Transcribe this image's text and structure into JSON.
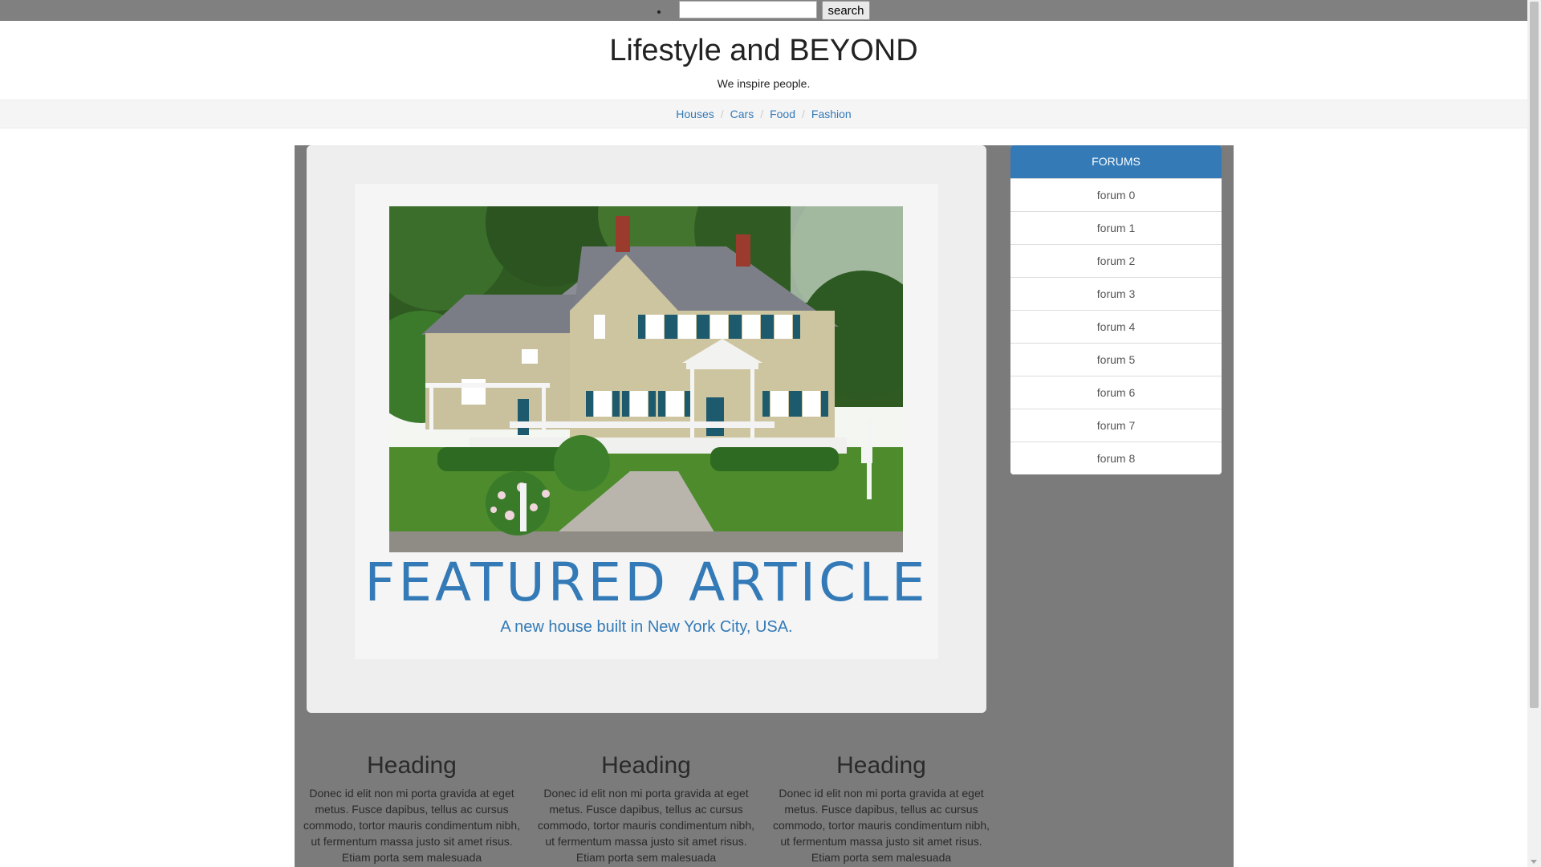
{
  "search": {
    "placeholder": "",
    "button_label": "search"
  },
  "header": {
    "title": "Lifestyle and BEYOND",
    "tagline": "We inspire people."
  },
  "nav": {
    "items": [
      "Houses",
      "Cars",
      "Food",
      "Fashion"
    ],
    "separator": "/"
  },
  "feature": {
    "image_alt": "house",
    "title": "FEATURED ARTICLE",
    "subtitle": "A new house built in New York City, USA."
  },
  "forums": {
    "header": "FORUMS",
    "items": [
      "forum 0",
      "forum 1",
      "forum 2",
      "forum 3",
      "forum 4",
      "forum 5",
      "forum 6",
      "forum 7",
      "forum 8"
    ]
  },
  "columns": [
    {
      "heading": "Heading",
      "text": "Donec id elit non mi porta gravida at eget metus. Fusce dapibus, tellus ac cursus commodo, tortor mauris condimentum nibh, ut fermentum massa justo sit amet risus. Etiam porta sem malesuada"
    },
    {
      "heading": "Heading",
      "text": "Donec id elit non mi porta gravida at eget metus. Fusce dapibus, tellus ac cursus commodo, tortor mauris condimentum nibh, ut fermentum massa justo sit amet risus. Etiam porta sem malesuada"
    },
    {
      "heading": "Heading",
      "text": "Donec id elit non mi porta gravida at eget metus. Fusce dapibus, tellus ac cursus commodo, tortor mauris condimentum nibh, ut fermentum massa justo sit amet risus. Etiam porta sem malesuada"
    }
  ],
  "colors": {
    "accent": "#337ab7",
    "topbar": "#808080",
    "container": "#7b7b7b"
  }
}
